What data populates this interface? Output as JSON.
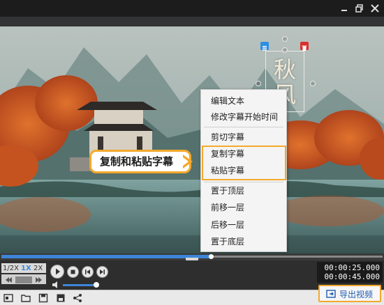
{
  "video": {
    "caption_text": "秋\n风"
  },
  "callout": {
    "label": "复制和粘贴字幕"
  },
  "context_menu": {
    "items": [
      "编辑文本",
      "修改字幕开始时间",
      "剪切字幕",
      "复制字幕",
      "粘贴字幕",
      "置于顶层",
      "前移一层",
      "后移一层",
      "置于底层"
    ],
    "highlighted": [
      "复制字幕",
      "粘贴字幕"
    ]
  },
  "playback": {
    "speed_options": [
      "1/2X",
      "1X",
      "2X"
    ],
    "selected_speed": "1X",
    "progress": 0.55,
    "volume": 0.85,
    "current_time": "00:00:25.000",
    "total_time": "00:00:45.000"
  },
  "toolbar": {
    "export_label": "导出视频"
  },
  "colors": {
    "accent": "#3c86d8",
    "highlight": "#f4a92b",
    "delete": "#d9302e"
  }
}
